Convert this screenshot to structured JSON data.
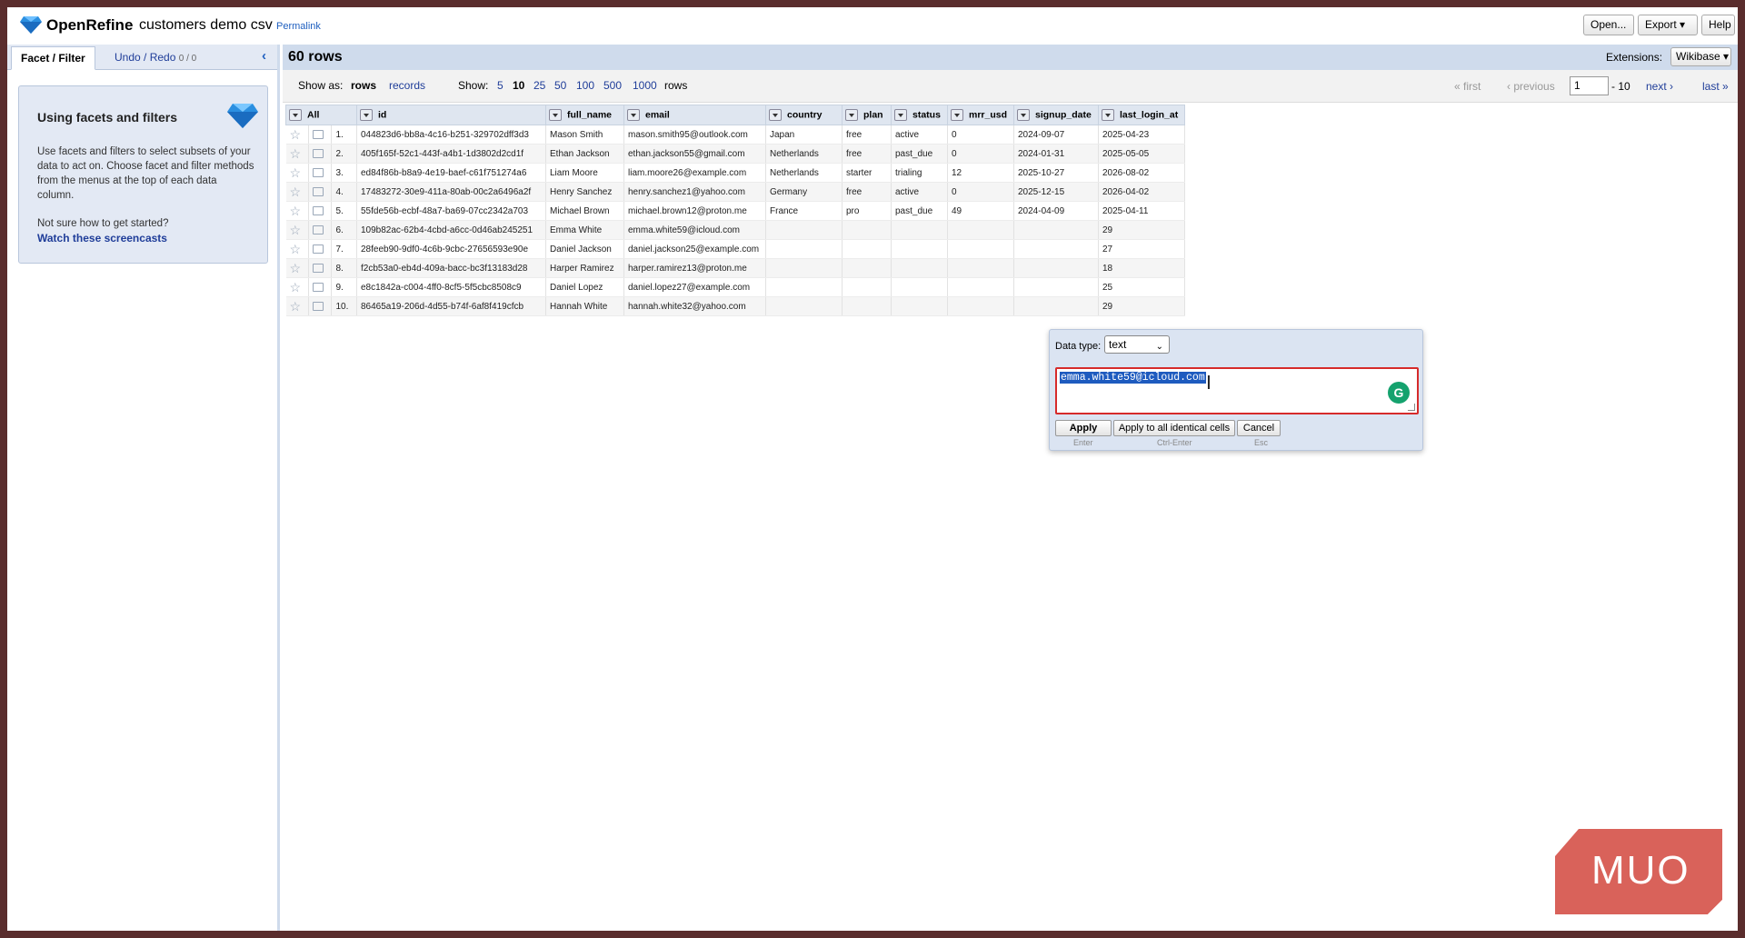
{
  "header": {
    "app_name": "OpenRefine",
    "project_name": "customers demo csv",
    "permalink": "Permalink",
    "open_label": "Open...",
    "export_label": "Export ▾",
    "help_label": "Help"
  },
  "left": {
    "tab_facet": "Facet / Filter",
    "tab_undo": "Undo / Redo",
    "tab_undo_count": "0 / 0",
    "help_title": "Using facets and filters",
    "help_text": "Use facets and filters to select subsets of your data to act on. Choose facet and filter methods from the menus at the top of each data column.",
    "help_question": "Not sure how to get started?",
    "help_link": "Watch these screencasts"
  },
  "summary": {
    "row_count": "60 rows",
    "extensions_label": "Extensions:",
    "extensions_value": "Wikibase ▾"
  },
  "viewbar": {
    "show_as": "Show as:",
    "rows_mode": "rows",
    "records_mode": "records",
    "show": "Show:",
    "sizes": [
      "5",
      "10",
      "25",
      "50",
      "100",
      "500",
      "1000"
    ],
    "rows_suffix": "rows",
    "first": "« first",
    "previous": "‹ previous",
    "page": "1",
    "page_of": "- 10",
    "next": "next ›",
    "last": "last »"
  },
  "table": {
    "all_label": "All",
    "columns": [
      "id",
      "full_name",
      "email",
      "country",
      "plan",
      "status",
      "mrr_usd",
      "signup_date",
      "last_login_at"
    ],
    "rows": [
      [
        "1.",
        "044823d6-bb8a-4c16-b251-329702dff3d3",
        "Mason Smith",
        "mason.smith95@outlook.com",
        "Japan",
        "free",
        "active",
        "0",
        "2024-09-07",
        "2025-04-23"
      ],
      [
        "2.",
        "405f165f-52c1-443f-a4b1-1d3802d2cd1f",
        "Ethan Jackson",
        "ethan.jackson55@gmail.com",
        "Netherlands",
        "free",
        "past_due",
        "0",
        "2024-01-31",
        "2025-05-05"
      ],
      [
        "3.",
        "ed84f86b-b8a9-4e19-baef-c61f751274a6",
        "Liam Moore",
        "liam.moore26@example.com",
        "Netherlands",
        "starter",
        "trialing",
        "12",
        "2025-10-27",
        "2026-08-02"
      ],
      [
        "4.",
        "17483272-30e9-411a-80ab-00c2a6496a2f",
        "Henry Sanchez",
        "henry.sanchez1@yahoo.com",
        "Germany",
        "free",
        "active",
        "0",
        "2025-12-15",
        "2026-04-02"
      ],
      [
        "5.",
        "55fde56b-ecbf-48a7-ba69-07cc2342a703",
        "Michael Brown",
        "michael.brown12@proton.me",
        "France",
        "pro",
        "past_due",
        "49",
        "2024-04-09",
        "2025-04-11"
      ],
      [
        "6.",
        "109b82ac-62b4-4cbd-a6cc-0d46ab245251",
        "Emma White",
        "emma.white59@icloud.com",
        "",
        "",
        "",
        "",
        "",
        "29"
      ],
      [
        "7.",
        "28feeb90-9df0-4c6b-9cbc-27656593e90e",
        "Daniel Jackson",
        "daniel.jackson25@example.com",
        "",
        "",
        "",
        "",
        "",
        "27"
      ],
      [
        "8.",
        "f2cb53a0-eb4d-409a-bacc-bc3f13183d28",
        "Harper Ramirez",
        "harper.ramirez13@proton.me",
        "",
        "",
        "",
        "",
        "",
        "18"
      ],
      [
        "9.",
        "e8c1842a-c004-4ff0-8cf5-5f5cbc8508c9",
        "Daniel Lopez",
        "daniel.lopez27@example.com",
        "",
        "",
        "",
        "",
        "",
        "25"
      ],
      [
        "10.",
        "86465a19-206d-4d55-b74f-6af8f419cfcb",
        "Hannah White",
        "hannah.white32@yahoo.com",
        "",
        "",
        "",
        "",
        "",
        "29"
      ]
    ]
  },
  "editor": {
    "dtype_label": "Data type:",
    "dtype_value": "text",
    "value": "emma.white59@icloud.com",
    "apply": "Apply",
    "apply_hint": "Enter",
    "apply_all": "Apply to all identical cells",
    "apply_all_hint": "Ctrl-Enter",
    "cancel": "Cancel",
    "cancel_hint": "Esc",
    "grammarly_letter": "G"
  },
  "watermark": {
    "text": "MUO",
    "color": "#d9625a"
  },
  "colors": {
    "accent": "#1f3d99",
    "header_blue": "#cfdbec",
    "editor_border": "#d62b2b"
  }
}
